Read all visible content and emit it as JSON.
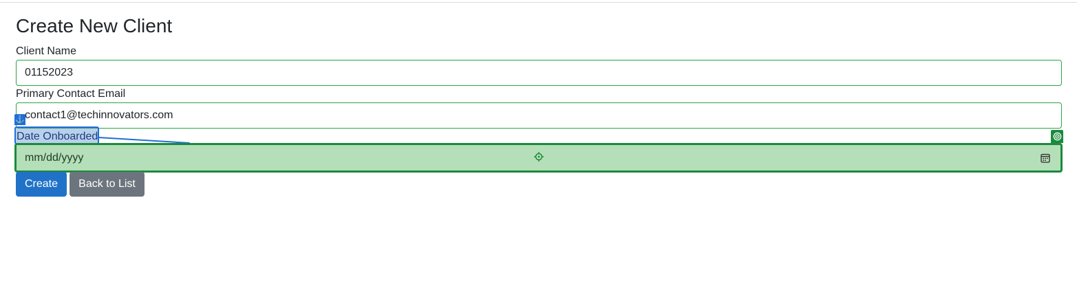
{
  "page": {
    "title": "Create New Client"
  },
  "form": {
    "client_name": {
      "label": "Client Name",
      "value": "01152023"
    },
    "primary_contact_email": {
      "label": "Primary Contact Email",
      "value": "contact1@techinnovators.com"
    },
    "date_onboarded": {
      "label": "Date Onboarded",
      "placeholder": "mm/dd/yyyy"
    }
  },
  "buttons": {
    "create": "Create",
    "back_to_list": "Back to List"
  },
  "overlay": {
    "anchor_icon": "anchor-icon",
    "target_icon": "target-icon",
    "crosshair_icon": "crosshair-icon",
    "label_highlight_color": "#1e6fd9",
    "field_highlight_color": "#1c8a3c"
  },
  "colors": {
    "valid_border": "#28a745",
    "primary": "#1f72c7",
    "secondary": "#6c757d"
  }
}
